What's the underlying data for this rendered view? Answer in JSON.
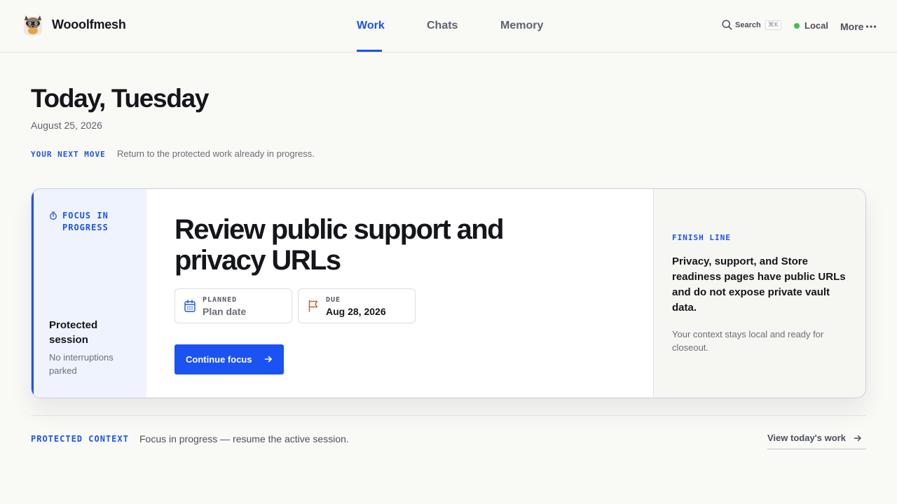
{
  "app": {
    "name": "Wooolfmesh",
    "logo_icon": "raccoon-mascot-icon"
  },
  "nav": {
    "tabs": [
      {
        "label": "Work",
        "active": true
      },
      {
        "label": "Chats",
        "active": false
      },
      {
        "label": "Memory",
        "active": false
      }
    ],
    "search_label": "Search",
    "search_shortcut": "⌘K",
    "status_label": "Local",
    "status_color": "#3ec24a",
    "more_label": "More",
    "more_icon": "ellipsis-icon"
  },
  "page": {
    "title": "Today, Tuesday",
    "date": "August 25, 2026",
    "next_move_label": "YOUR NEXT MOVE",
    "next_move_text": "Return to the protected work already in progress."
  },
  "focus_card": {
    "badge_label": "FOCUS IN PROGRESS",
    "badge_icon": "stopwatch-icon",
    "side_title": "Protected session",
    "side_subtitle": "No interruptions parked",
    "task_title": "Review public support and privacy URLs",
    "planned_label": "PLANNED",
    "planned_value": "Plan date",
    "planned_icon": "calendar-icon",
    "due_label": "DUE",
    "due_value": "Aug 28, 2026",
    "due_icon": "flag-icon",
    "continue_label": "Continue focus",
    "continue_icon": "arrow-right-icon",
    "finish_label": "FINISH LINE",
    "finish_text": "Privacy, support, and Store readiness pages have public URLs and do not expose private vault data.",
    "finish_subtext": "Your context stays local and ready for closeout."
  },
  "footer": {
    "context_label": "PROTECTED CONTEXT",
    "context_text": "Focus in progress — resume the active session.",
    "view_link_label": "View today's work",
    "view_link_icon": "arrow-right-icon"
  },
  "colors": {
    "accent": "#1b53f2",
    "background": "#f9f9f6",
    "due_flag": "#c0652a"
  }
}
